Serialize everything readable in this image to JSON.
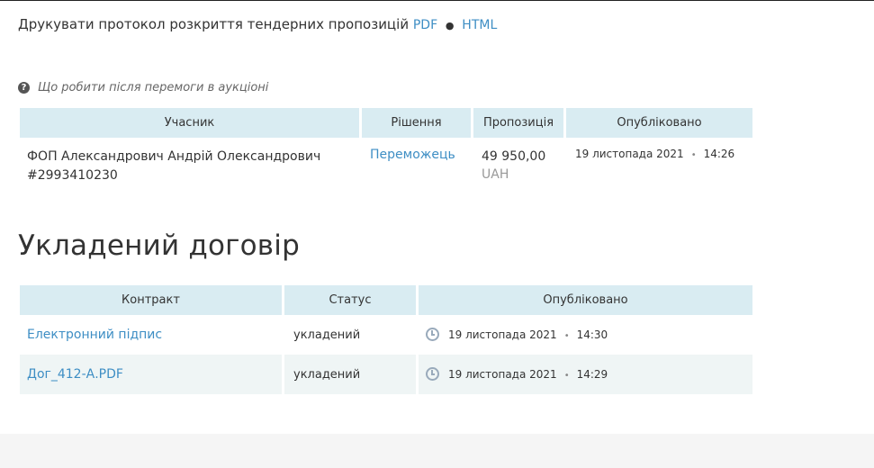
{
  "print": {
    "label": "Друкувати протокол розкриття тендерних пропозицій",
    "pdf": "PDF",
    "dot": "●",
    "html": "HTML"
  },
  "help": {
    "icon": "?",
    "text": "Що робити після перемоги в аукціоні"
  },
  "award_table": {
    "headers": [
      "Учасник",
      "Рішення",
      "Пропозиція",
      "Опубліковано"
    ],
    "rows": [
      {
        "participant": "ФОП Александрович Андрій Олександрович",
        "participant_id": "#2993410230",
        "decision": "Переможець",
        "amount": "49 950,00",
        "currency": "UAH",
        "date": "19 листопада 2021",
        "sep": "•",
        "time": "14:26"
      }
    ]
  },
  "contract_section": {
    "title": "Укладений договір",
    "headers": [
      "Контракт",
      "Статус",
      "Опубліковано"
    ],
    "rows": [
      {
        "name": "Електронний підпис",
        "status": "укладений",
        "date": "19 листопада 2021",
        "sep": "•",
        "time": "14:30"
      },
      {
        "name": "Дог_412-А.PDF",
        "status": "укладений",
        "date": "19 листопада 2021",
        "sep": "•",
        "time": "14:29"
      }
    ]
  },
  "colors": {
    "accent": "#3e8ec4",
    "header_bg": "#d9ecf2",
    "alt_row_bg": "#eff5f5"
  },
  "icons": {
    "help": "question-circle-icon",
    "clock": "clock-icon"
  }
}
